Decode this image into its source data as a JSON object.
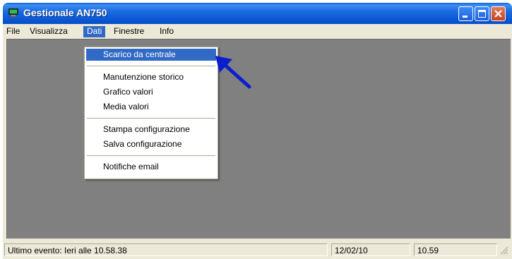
{
  "window": {
    "title": "Gestionale AN750",
    "controls": [
      "minimize-icon",
      "maximize-icon",
      "close-icon"
    ]
  },
  "menubar": {
    "items": [
      {
        "label": "File"
      },
      {
        "label": "Visualizza"
      },
      {
        "label": "Dati"
      },
      {
        "label": "Finestre"
      },
      {
        "label": "Info"
      }
    ],
    "active": "Dati"
  },
  "dropdown": {
    "groups": [
      [
        "Scarico da centrale"
      ],
      [
        "Manutenzione storico",
        "Grafico valori",
        "Media valori"
      ],
      [
        "Stampa configurazione",
        "Salva configurazione"
      ],
      [
        "Notifiche email"
      ]
    ],
    "highlighted": "Scarico da centrale"
  },
  "statusbar": {
    "event": "Ultimo evento: Ieri alle 10.58.38",
    "date": "12/02/10",
    "time": "10.59"
  },
  "colors": {
    "titlebar": "#0a5fd6",
    "menu_highlight": "#316ac5",
    "client_background": "#808080",
    "annotation_arrow": "#0a1ed0"
  }
}
